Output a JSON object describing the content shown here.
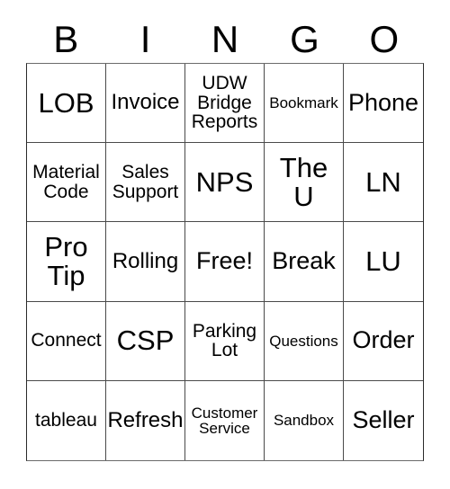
{
  "card": {
    "title": "BINGO",
    "headers": [
      "B",
      "I",
      "N",
      "G",
      "O"
    ],
    "rows": [
      [
        {
          "text": "LOB",
          "size": "fs-xl"
        },
        {
          "text": "Invoice",
          "size": "fs-md"
        },
        {
          "text": "UDW\nBridge\nReports",
          "size": "fs-sm"
        },
        {
          "text": "Bookmark",
          "size": "fs-xs"
        },
        {
          "text": "Phone",
          "size": "fs-lg"
        }
      ],
      [
        {
          "text": "Material\nCode",
          "size": "fs-sm"
        },
        {
          "text": "Sales\nSupport",
          "size": "fs-sm"
        },
        {
          "text": "NPS",
          "size": "fs-xl"
        },
        {
          "text": "The\nU",
          "size": "fs-xl"
        },
        {
          "text": "LN",
          "size": "fs-xl"
        }
      ],
      [
        {
          "text": "Pro\nTip",
          "size": "fs-xl"
        },
        {
          "text": "Rolling",
          "size": "fs-md"
        },
        {
          "text": "Free!",
          "size": "fs-lg"
        },
        {
          "text": "Break",
          "size": "fs-lg"
        },
        {
          "text": "LU",
          "size": "fs-xl"
        }
      ],
      [
        {
          "text": "Connect",
          "size": "fs-sm"
        },
        {
          "text": "CSP",
          "size": "fs-xl"
        },
        {
          "text": "Parking\nLot",
          "size": "fs-sm"
        },
        {
          "text": "Questions",
          "size": "fs-xs"
        },
        {
          "text": "Order",
          "size": "fs-lg"
        }
      ],
      [
        {
          "text": "tableau",
          "size": "fs-sm"
        },
        {
          "text": "Refresh",
          "size": "fs-md"
        },
        {
          "text": "Customer\nService",
          "size": "fs-xs"
        },
        {
          "text": "Sandbox",
          "size": "fs-xs"
        },
        {
          "text": "Seller",
          "size": "fs-lg"
        }
      ]
    ],
    "free_space": {
      "row": 2,
      "col": 2,
      "label": "Free!"
    },
    "colors": {
      "text": "#000000",
      "background": "#ffffff",
      "grid_line": "#4a4a4a",
      "outer_border": "#2a2a2a"
    }
  }
}
